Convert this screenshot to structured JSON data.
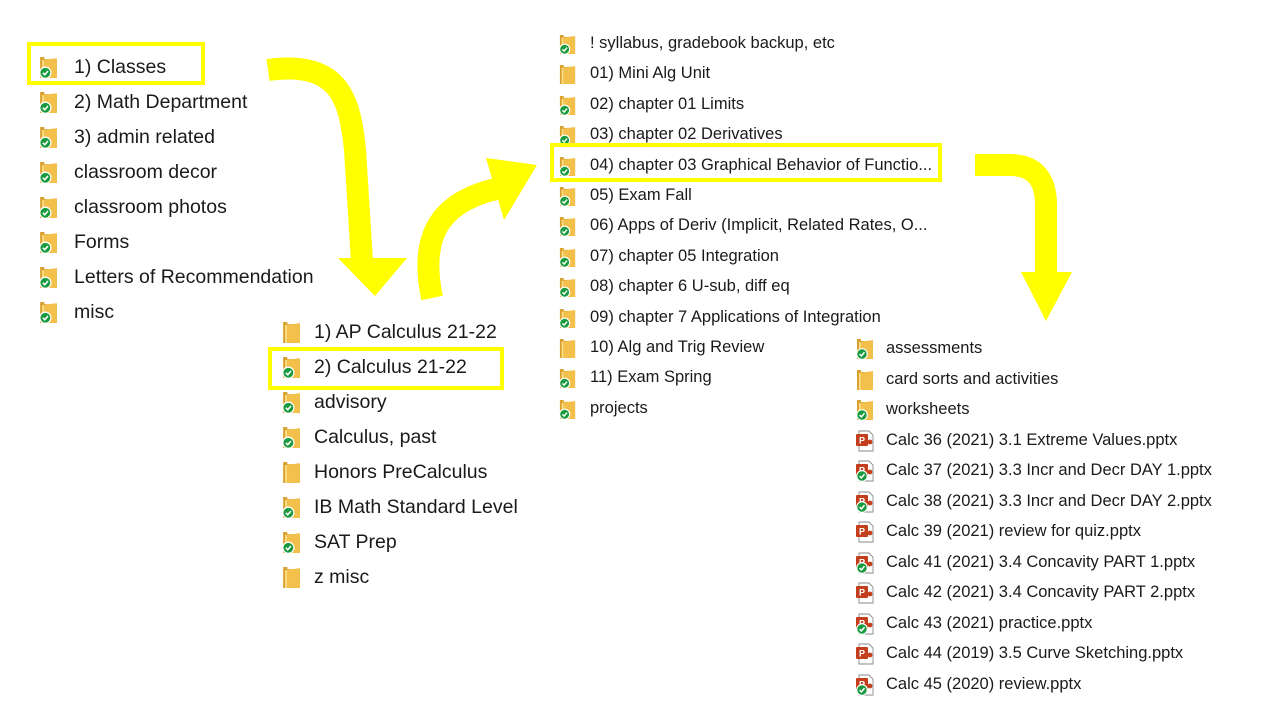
{
  "colors": {
    "highlight": "#ffff00",
    "folder": "#f2c04b",
    "folder_dark": "#d9a230",
    "sync_badge": "#1a9a3f",
    "pptx": "#c43e1c"
  },
  "icons": {
    "folder": "folder-icon",
    "synced": "sync-check-icon",
    "pptx": "powerpoint-file-icon",
    "arrow": "yellow-arrow"
  },
  "top_level": {
    "items": [
      {
        "label": "1) Classes",
        "synced": true,
        "highlighted": true
      },
      {
        "label": "2) Math Department",
        "synced": true
      },
      {
        "label": "3) admin related",
        "synced": true
      },
      {
        "label": "classroom decor",
        "synced": true
      },
      {
        "label": "classroom photos",
        "synced": true
      },
      {
        "label": "Forms",
        "synced": true
      },
      {
        "label": "Letters of Recommendation",
        "synced": true
      },
      {
        "label": "misc",
        "synced": true
      }
    ]
  },
  "classes": {
    "items": [
      {
        "label": "1) AP Calculus 21-22",
        "synced": false
      },
      {
        "label": "2) Calculus 21-22",
        "synced": true,
        "highlighted": true
      },
      {
        "label": "advisory",
        "synced": true
      },
      {
        "label": "Calculus, past",
        "synced": true
      },
      {
        "label": "Honors PreCalculus",
        "synced": false
      },
      {
        "label": "IB Math Standard Level",
        "synced": true
      },
      {
        "label": "SAT Prep",
        "synced": true
      },
      {
        "label": "z misc",
        "synced": false
      }
    ]
  },
  "calculus": {
    "items": [
      {
        "label": "! syllabus, gradebook backup, etc",
        "synced": true
      },
      {
        "label": "01) Mini Alg Unit",
        "synced": false
      },
      {
        "label": "02) chapter 01 Limits",
        "synced": true
      },
      {
        "label": "03) chapter 02 Derivatives",
        "synced": true
      },
      {
        "label": "04) chapter 03 Graphical Behavior of Functio...",
        "synced": true,
        "highlighted": true
      },
      {
        "label": "05) Exam Fall",
        "synced": true
      },
      {
        "label": "06) Apps of Deriv (Implicit, Related Rates, O...",
        "synced": true
      },
      {
        "label": "07) chapter 05 Integration",
        "synced": true
      },
      {
        "label": "08) chapter 6 U-sub, diff eq",
        "synced": true
      },
      {
        "label": "09) chapter 7 Applications of Integration",
        "synced": true
      },
      {
        "label": "10) Alg and Trig Review",
        "synced": false
      },
      {
        "label": "11) Exam Spring",
        "synced": true
      },
      {
        "label": "projects",
        "synced": true
      }
    ]
  },
  "chapter03": {
    "items": [
      {
        "label": "assessments",
        "type": "folder",
        "synced": true
      },
      {
        "label": "card sorts and activities",
        "type": "folder",
        "synced": false
      },
      {
        "label": "worksheets",
        "type": "folder",
        "synced": true
      },
      {
        "label": "Calc 36 (2021) 3.1 Extreme Values.pptx",
        "type": "pptx",
        "synced": false
      },
      {
        "label": "Calc 37 (2021) 3.3 Incr and Decr DAY 1.pptx",
        "type": "pptx",
        "synced": true
      },
      {
        "label": "Calc 38 (2021) 3.3 Incr and Decr DAY 2.pptx",
        "type": "pptx",
        "synced": true
      },
      {
        "label": "Calc 39 (2021) review for quiz.pptx",
        "type": "pptx",
        "synced": false
      },
      {
        "label": "Calc 41 (2021) 3.4 Concavity PART 1.pptx",
        "type": "pptx",
        "synced": true
      },
      {
        "label": "Calc 42 (2021) 3.4 Concavity PART 2.pptx",
        "type": "pptx",
        "synced": false
      },
      {
        "label": "Calc 43 (2021) practice.pptx",
        "type": "pptx",
        "synced": true
      },
      {
        "label": "Calc 44 (2019) 3.5 Curve Sketching.pptx",
        "type": "pptx",
        "synced": false
      },
      {
        "label": "Calc 45 (2020) review.pptx",
        "type": "pptx",
        "synced": true
      }
    ]
  }
}
